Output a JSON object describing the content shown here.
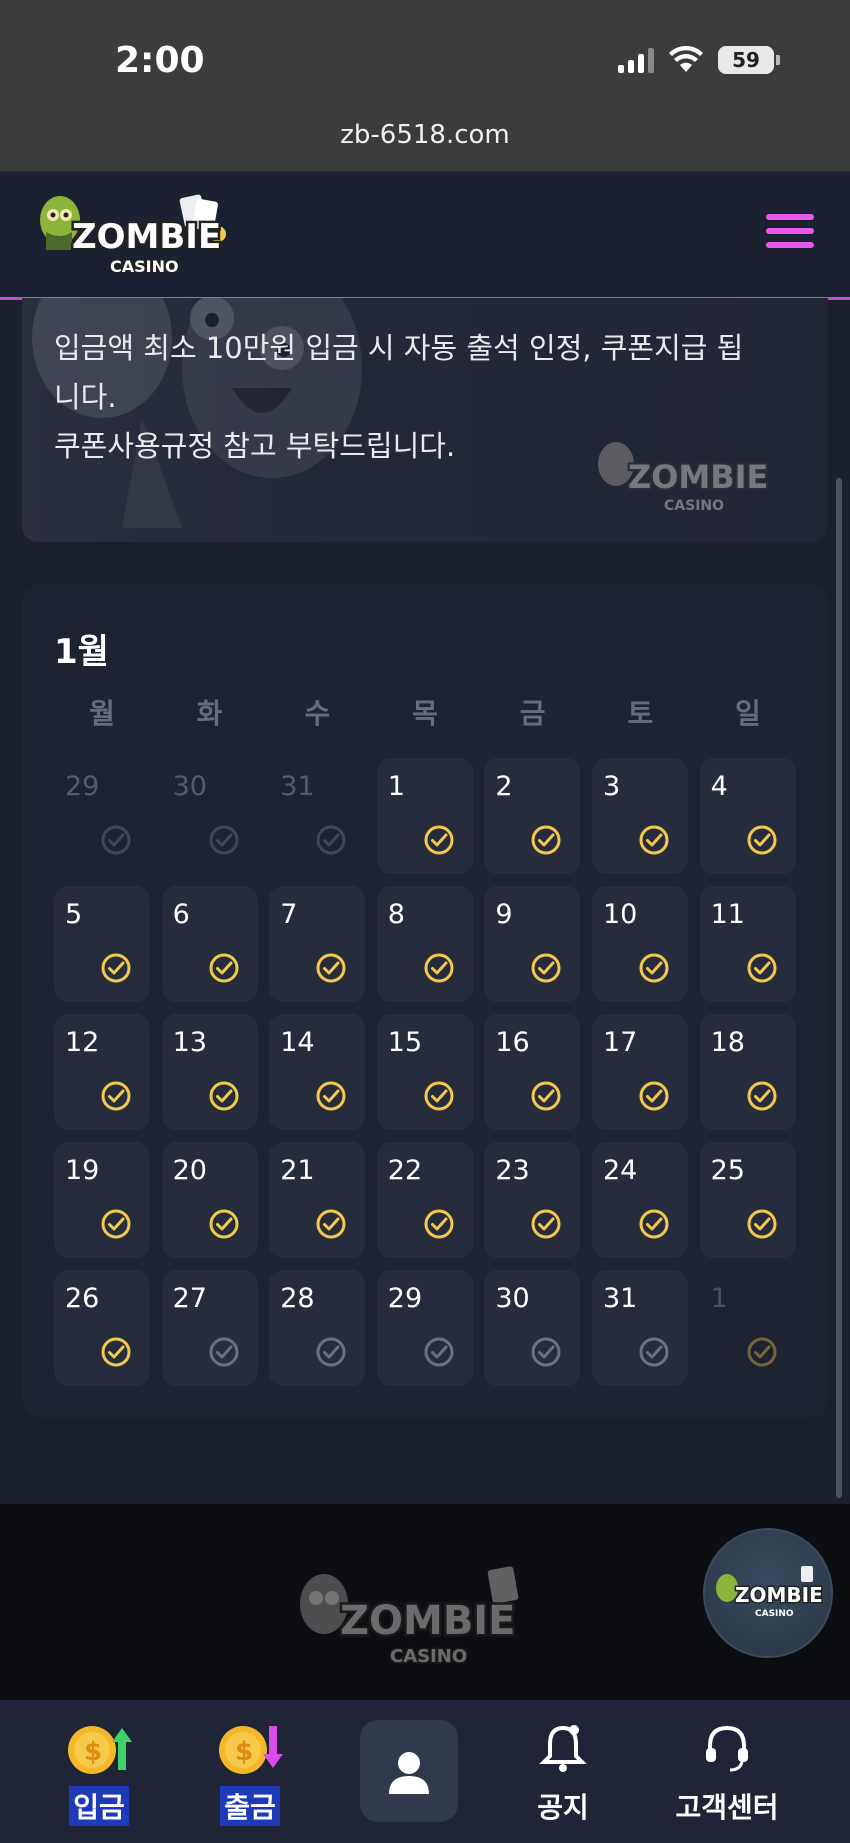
{
  "status_bar": {
    "time": "2:00",
    "battery": "59"
  },
  "browser": {
    "url": "zb-6518.com"
  },
  "header": {
    "logo_text": "ZOMBIE",
    "logo_sub": "CASINO"
  },
  "notice": {
    "line1": "입금액 최소 10만원 입금 시 자동 출석 인정, 쿠폰지급 됩",
    "line2": "니다.",
    "line3": "쿠폰사용규정 참고 부탁드립니다."
  },
  "calendar": {
    "month": "1월",
    "weekdays": [
      "월",
      "화",
      "수",
      "목",
      "금",
      "토",
      "일"
    ],
    "colors": {
      "checked": "#f2c94c",
      "unchecked": "#6b7180"
    },
    "days": [
      {
        "n": "29",
        "state": "prev"
      },
      {
        "n": "30",
        "state": "prev"
      },
      {
        "n": "31",
        "state": "prev"
      },
      {
        "n": "1",
        "state": "checked"
      },
      {
        "n": "2",
        "state": "checked"
      },
      {
        "n": "3",
        "state": "checked"
      },
      {
        "n": "4",
        "state": "checked"
      },
      {
        "n": "5",
        "state": "checked"
      },
      {
        "n": "6",
        "state": "checked"
      },
      {
        "n": "7",
        "state": "checked"
      },
      {
        "n": "8",
        "state": "checked"
      },
      {
        "n": "9",
        "state": "checked"
      },
      {
        "n": "10",
        "state": "checked"
      },
      {
        "n": "11",
        "state": "checked"
      },
      {
        "n": "12",
        "state": "checked"
      },
      {
        "n": "13",
        "state": "checked"
      },
      {
        "n": "14",
        "state": "checked"
      },
      {
        "n": "15",
        "state": "checked"
      },
      {
        "n": "16",
        "state": "checked"
      },
      {
        "n": "17",
        "state": "checked"
      },
      {
        "n": "18",
        "state": "checked"
      },
      {
        "n": "19",
        "state": "checked"
      },
      {
        "n": "20",
        "state": "checked"
      },
      {
        "n": "21",
        "state": "checked"
      },
      {
        "n": "22",
        "state": "checked"
      },
      {
        "n": "23",
        "state": "checked"
      },
      {
        "n": "24",
        "state": "checked"
      },
      {
        "n": "25",
        "state": "checked"
      },
      {
        "n": "26",
        "state": "checked"
      },
      {
        "n": "27",
        "state": "unchecked"
      },
      {
        "n": "28",
        "state": "unchecked"
      },
      {
        "n": "29",
        "state": "unchecked"
      },
      {
        "n": "30",
        "state": "unchecked"
      },
      {
        "n": "31",
        "state": "unchecked"
      },
      {
        "n": "1",
        "state": "next"
      }
    ]
  },
  "bottom_nav": {
    "deposit": "입금",
    "withdraw": "출금",
    "notice": "공지",
    "support": "고객센터"
  }
}
